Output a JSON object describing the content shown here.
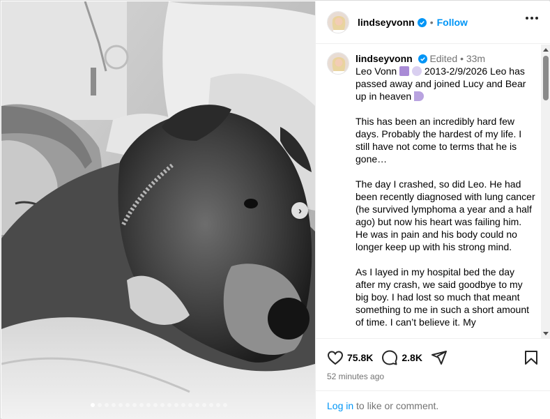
{
  "post": {
    "username": "lindseyvonn",
    "follow_label": "Follow",
    "separator": "•",
    "more_icon": "more-options-icon"
  },
  "caption": {
    "username": "lindseyvonn",
    "edited": "Edited",
    "dot": "•",
    "age": "33m",
    "line1_prefix": "Leo Vonn",
    "line1_suffix": "2013-2/9/2026 Leo has passed away and joined Lucy and Bear up in heaven",
    "paragraph2": "This has been an incredibly hard few days. Probably the hardest of my life. I still have not come to terms that he is gone…",
    "paragraph3": "The day I crashed, so did Leo. He had been recently diagnosed with lung cancer (he survived lymphoma a year and a half ago) but now his heart was failing him. He was in pain and his body could no longer keep up with his strong mind.",
    "paragraph4": "As I layed in my hospital bed the day after my crash, we said goodbye to my big boy. I had lost so much that meant something to me in such a short amount of time. I can’t believe it. My"
  },
  "actions": {
    "likes": "75.8K",
    "comments": "2.8K"
  },
  "timestamp": "52 minutes ago",
  "footer": {
    "login": "Log in",
    "rest": " to like or comment."
  },
  "carousel": {
    "total_slides": 20,
    "active_index": 0
  },
  "colors": {
    "link": "#0095f6",
    "muted": "#737373",
    "verified": "#0095f6"
  }
}
